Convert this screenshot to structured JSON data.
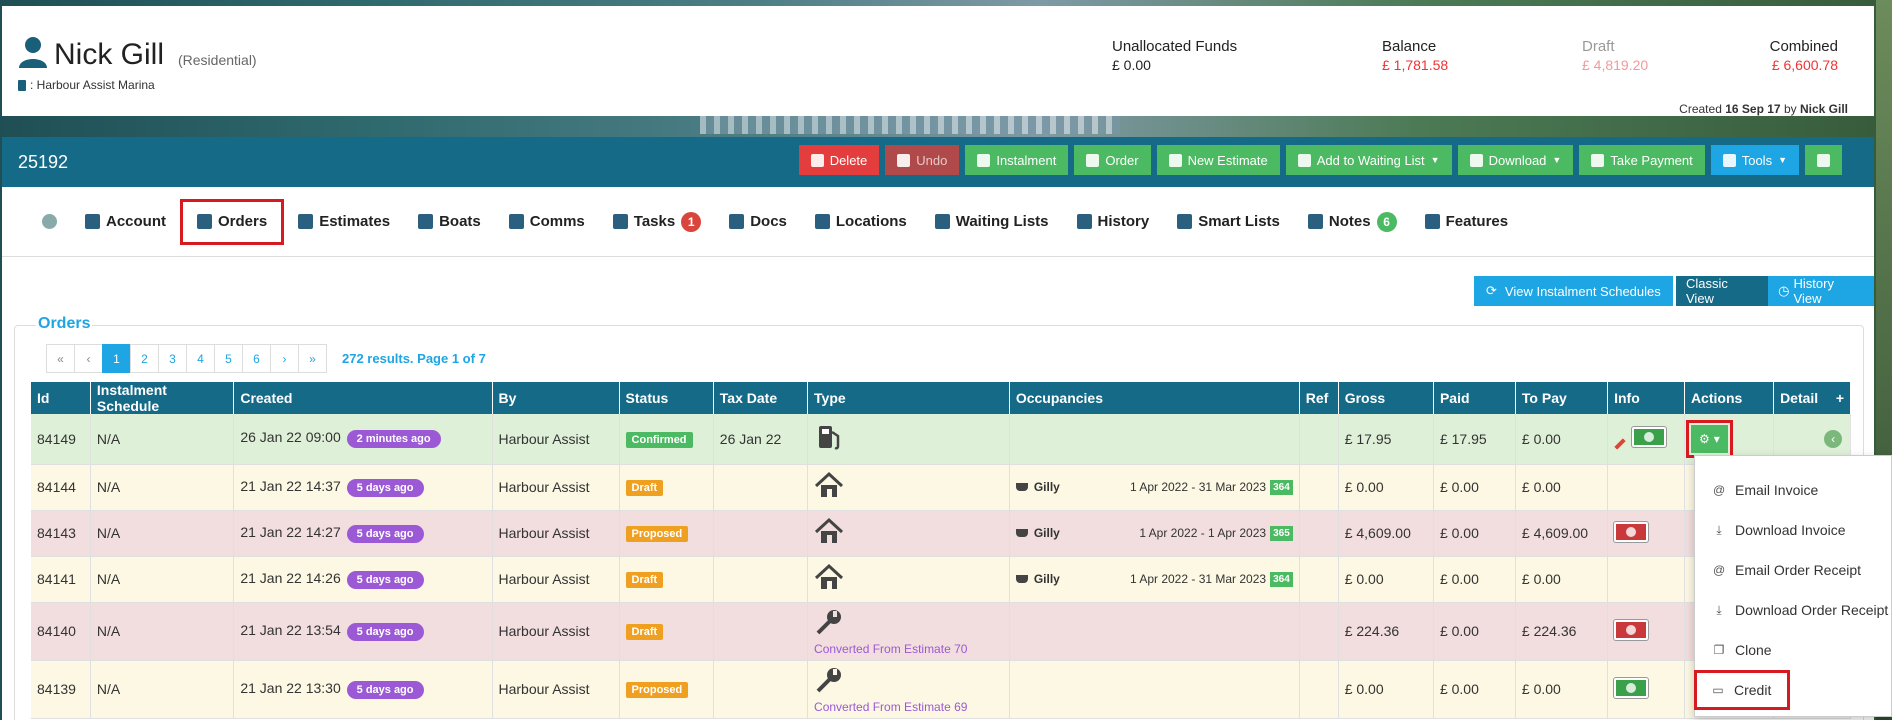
{
  "header": {
    "customer_name": "Nick Gill",
    "customer_type": "(Residential)",
    "marina": ": Harbour Assist Marina",
    "finance": {
      "unallocated_label": "Unallocated Funds",
      "unallocated_value": "£ 0.00",
      "balance_label": "Balance",
      "balance_value": "£ 1,781.58",
      "draft_label": "Draft",
      "draft_value": "£ 4,819.20",
      "combined_label": "Combined",
      "combined_value": "£ 6,600.78"
    },
    "created_prefix": "Created",
    "created_date": "16 Sep 17",
    "created_by_prefix": "by",
    "created_by": "Nick Gill"
  },
  "record": {
    "id": "25192",
    "toolbar": {
      "delete": "Delete",
      "undo": "Undo",
      "instalment": "Instalment",
      "order": "Order",
      "new_estimate": "New Estimate",
      "waiting_list": "Add to Waiting List",
      "download": "Download",
      "take_payment": "Take Payment",
      "tools": "Tools"
    }
  },
  "tabs": [
    {
      "label": "Account"
    },
    {
      "label": "Orders"
    },
    {
      "label": "Estimates"
    },
    {
      "label": "Boats"
    },
    {
      "label": "Comms"
    },
    {
      "label": "Tasks",
      "badge": "1"
    },
    {
      "label": "Docs"
    },
    {
      "label": "Locations"
    },
    {
      "label": "Waiting Lists"
    },
    {
      "label": "History"
    },
    {
      "label": "Smart Lists"
    },
    {
      "label": "Notes",
      "badge": "6"
    },
    {
      "label": "Features"
    }
  ],
  "views": {
    "instalment_schedules": "View Instalment Schedules",
    "classic": "Classic View",
    "history": "History View"
  },
  "orders": {
    "legend": "Orders",
    "pager": [
      "«",
      "‹",
      "1",
      "2",
      "3",
      "4",
      "5",
      "6",
      "›",
      "»"
    ],
    "results": "272 results. Page 1 of 7",
    "columns": [
      "Id",
      "Instalment Schedule",
      "Created",
      "By",
      "Status",
      "Tax Date",
      "Type",
      "Occupancies",
      "Ref",
      "Gross",
      "Paid",
      "To Pay",
      "Info",
      "Actions",
      "Detail"
    ],
    "detail_add": "+",
    "rows": [
      {
        "id": "84149",
        "inst": "N/A",
        "created": "26 Jan 22 09:00",
        "ago": "2 minutes ago",
        "by": "Harbour Assist",
        "status": "Confirmed",
        "tax_date": "26 Jan 22",
        "gross": "£ 17.95",
        "paid": "£ 17.95",
        "to_pay": "£ 0.00"
      },
      {
        "id": "84144",
        "inst": "N/A",
        "created": "21 Jan 22 14:37",
        "ago": "5 days ago",
        "by": "Harbour Assist",
        "status": "Draft",
        "tax_date": "",
        "occ_boat": "Gilly",
        "occ_dates": "1 Apr 2022 - 31 Mar 2023",
        "occ_days": "364",
        "gross": "£ 0.00",
        "paid": "£ 0.00",
        "to_pay": "£ 0.00"
      },
      {
        "id": "84143",
        "inst": "N/A",
        "created": "21 Jan 22 14:27",
        "ago": "5 days ago",
        "by": "Harbour Assist",
        "status": "Proposed",
        "tax_date": "",
        "occ_boat": "Gilly",
        "occ_dates": "1 Apr 2022 - 1 Apr 2023",
        "occ_days": "365",
        "gross": "£ 4,609.00",
        "paid": "£ 0.00",
        "to_pay": "£ 4,609.00"
      },
      {
        "id": "84141",
        "inst": "N/A",
        "created": "21 Jan 22 14:26",
        "ago": "5 days ago",
        "by": "Harbour Assist",
        "status": "Draft",
        "tax_date": "",
        "occ_boat": "Gilly",
        "occ_dates": "1 Apr 2022 - 31 Mar 2023",
        "occ_days": "364",
        "gross": "£ 0.00",
        "paid": "£ 0.00",
        "to_pay": "£ 0.00"
      },
      {
        "id": "84140",
        "inst": "N/A",
        "created": "21 Jan 22 13:54",
        "ago": "5 days ago",
        "by": "Harbour Assist",
        "status": "Draft",
        "tax_date": "",
        "converted": "Converted From Estimate 70",
        "gross": "£ 224.36",
        "paid": "£ 0.00",
        "to_pay": "£ 224.36"
      },
      {
        "id": "84139",
        "inst": "N/A",
        "created": "21 Jan 22 13:30",
        "ago": "5 days ago",
        "by": "Harbour Assist",
        "status": "Proposed",
        "tax_date": "",
        "converted": "Converted From Estimate 69",
        "gross": "£ 0.00",
        "paid": "£ 0.00",
        "to_pay": "£ 0.00"
      }
    ]
  },
  "actions_menu": [
    {
      "label": "Email Invoice",
      "icon": "at-icon"
    },
    {
      "label": "Download Invoice",
      "icon": "download-icon"
    },
    {
      "label": "Email Order Receipt",
      "icon": "at-icon"
    },
    {
      "label": "Download Order Receipt",
      "icon": "download-icon"
    },
    {
      "label": "Clone",
      "icon": "clone-icon"
    },
    {
      "label": "Credit",
      "icon": "money-icon"
    }
  ],
  "colors": {
    "primary": "#156a88",
    "accent": "#1ea5e3",
    "success": "#4cba62",
    "danger": "#e43d3d",
    "highlight": "#d71920"
  }
}
